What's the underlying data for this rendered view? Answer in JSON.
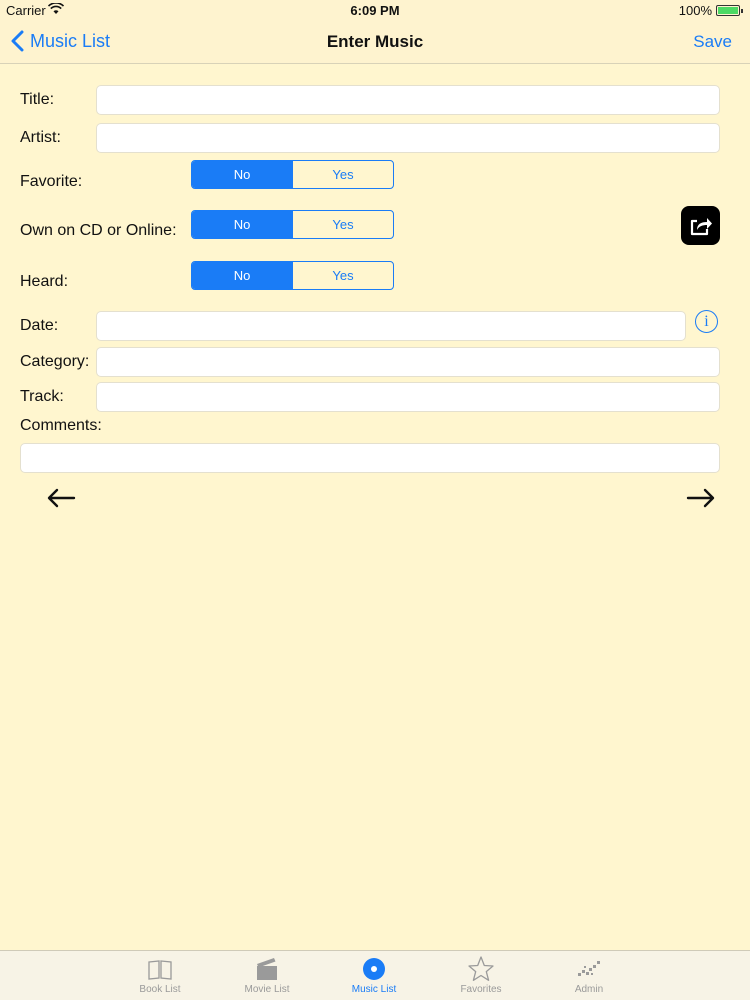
{
  "status_bar": {
    "carrier": "Carrier",
    "time": "6:09 PM",
    "battery": "100%"
  },
  "nav": {
    "back_label": "Music List",
    "title": "Enter Music",
    "save_label": "Save"
  },
  "form": {
    "title_label": "Title:",
    "title_value": "",
    "artist_label": "Artist:",
    "artist_value": "",
    "favorite_label": "Favorite:",
    "own_label": "Own on CD or Online:",
    "heard_label": "Heard:",
    "date_label": "Date:",
    "date_value": "",
    "category_label": "Category:",
    "category_value": "",
    "track_label": "Track:",
    "track_value": "",
    "comments_label": "Comments:",
    "comments_value": "",
    "toggle_no": "No",
    "toggle_yes": "Yes",
    "favorite_selected": "No",
    "own_selected": "No",
    "heard_selected": "No"
  },
  "icons": {
    "share": "share-icon",
    "info": "info-icon",
    "prev": "arrow-left-icon",
    "next": "arrow-right-icon"
  },
  "tabs": [
    {
      "label": "Book List",
      "icon": "book-icon",
      "active": false
    },
    {
      "label": "Movie List",
      "icon": "clapperboard-icon",
      "active": false
    },
    {
      "label": "Music List",
      "icon": "record-icon",
      "active": true
    },
    {
      "label": "Favorites",
      "icon": "star-icon",
      "active": false
    },
    {
      "label": "Admin",
      "icon": "admin-icon",
      "active": false
    }
  ],
  "colors": {
    "accent": "#1a7cf6",
    "background": "#fff6cf",
    "bar_background": "#fef3cf"
  }
}
